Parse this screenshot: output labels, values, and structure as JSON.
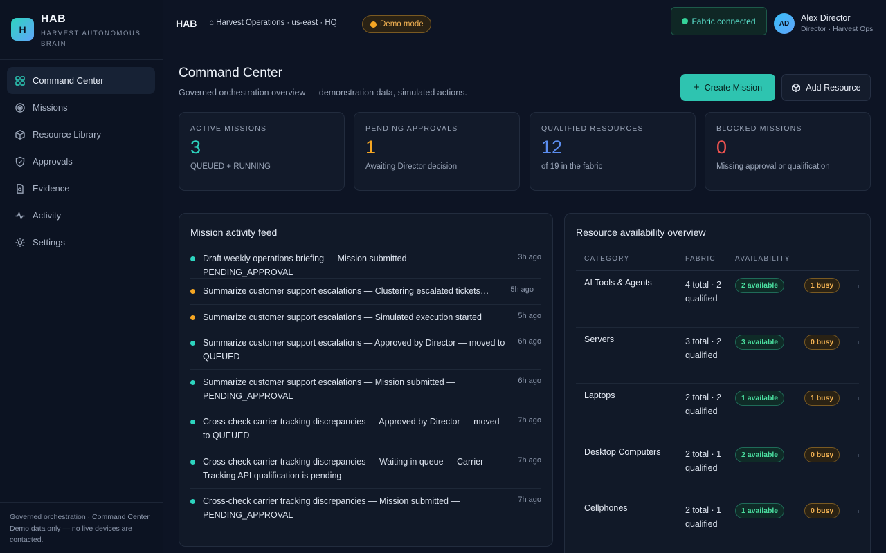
{
  "brand": {
    "logo_letter": "H",
    "name": "HAB",
    "subtitle": "HARVEST AUTONOMOUS BRAIN"
  },
  "nav": [
    {
      "label": "Command Center",
      "icon": "grid-icon",
      "active": true
    },
    {
      "label": "Missions",
      "icon": "target-icon"
    },
    {
      "label": "Resource Library",
      "icon": "box-icon"
    },
    {
      "label": "Approvals",
      "icon": "shield-icon"
    },
    {
      "label": "Evidence",
      "icon": "file-search-icon"
    },
    {
      "label": "Activity",
      "icon": "pulse-icon"
    },
    {
      "label": "Settings",
      "icon": "sun-gear-icon"
    }
  ],
  "sidebar_footer": {
    "line1": "Governed orchestration · Command Center",
    "line2": "Demo data only — no live devices are contacted."
  },
  "topbar": {
    "app": "HAB",
    "breadcrumb": "⌂ Harvest Operations · us-east · HQ",
    "demo_badge": "Demo mode",
    "fabric_status": "Fabric connected",
    "user": {
      "initials": "AD",
      "name": "Alex Director",
      "role": "Director · Harvest Ops"
    }
  },
  "header": {
    "title": "Command Center",
    "subtitle": "Governed orchestration overview — demonstration data, simulated actions.",
    "create_label": "Create Mission",
    "add_label": "Add Resource"
  },
  "colors": {
    "teal": "#2dd4bf",
    "amber": "#f5a623",
    "blue": "#5b8def",
    "red": "#ef5350"
  },
  "stats": [
    {
      "label": "ACTIVE MISSIONS",
      "value": "3",
      "desc": "QUEUED + RUNNING",
      "color": "#2dd4bf"
    },
    {
      "label": "PENDING APPROVALS",
      "value": "1",
      "desc": "Awaiting Director decision",
      "color": "#f5a623"
    },
    {
      "label": "QUALIFIED RESOURCES",
      "value": "12",
      "desc": "of 19 in the fabric",
      "color": "#5b8def"
    },
    {
      "label": "BLOCKED MISSIONS",
      "value": "0",
      "desc": "Missing approval or qualification",
      "color": "#ef5350"
    }
  ],
  "feed": {
    "title": "Mission activity feed",
    "items": [
      {
        "text": "Draft weekly operations briefing — Mission submitted — PENDING_APPROVAL",
        "time": "3h ago",
        "status": "teal"
      },
      {
        "text": "Summarize customer support escalations — Clustering escalated tickets…",
        "time": "5h ago",
        "status": "amber"
      },
      {
        "text": "Summarize customer support escalations — Simulated execution started",
        "time": "5h ago",
        "status": "amber"
      },
      {
        "text": "Summarize customer support escalations — Approved by Director — moved to QUEUED",
        "time": "6h ago",
        "status": "teal"
      },
      {
        "text": "Summarize customer support escalations — Mission submitted — PENDING_APPROVAL",
        "time": "6h ago",
        "status": "teal"
      },
      {
        "text": "Cross-check carrier tracking discrepancies — Approved by Director — moved to QUEUED",
        "time": "7h ago",
        "status": "teal"
      },
      {
        "text": "Cross-check carrier tracking discrepancies — Waiting in queue — Carrier Tracking API qualification is pending",
        "time": "7h ago",
        "status": "teal"
      },
      {
        "text": "Cross-check carrier tracking discrepancies — Mission submitted — PENDING_APPROVAL",
        "time": "7h ago",
        "status": "teal"
      }
    ]
  },
  "resources": {
    "title": "Resource availability overview",
    "columns": [
      "CATEGORY",
      "FABRIC",
      "AVAILABILITY"
    ],
    "rows": [
      {
        "category": "AI Tools & Agents",
        "fabric": "4 total · 2 qualified",
        "available": "2 available",
        "busy": "1 busy"
      },
      {
        "category": "Servers",
        "fabric": "3 total · 2 qualified",
        "available": "3 available",
        "busy": "0 busy"
      },
      {
        "category": "Laptops",
        "fabric": "2 total · 2 qualified",
        "available": "1 available",
        "busy": "1 busy"
      },
      {
        "category": "Desktop Computers",
        "fabric": "2 total · 1 qualified",
        "available": "2 available",
        "busy": "0 busy"
      },
      {
        "category": "Cellphones",
        "fabric": "2 total · 1 qualified",
        "available": "1 available",
        "busy": "0 busy"
      }
    ]
  }
}
